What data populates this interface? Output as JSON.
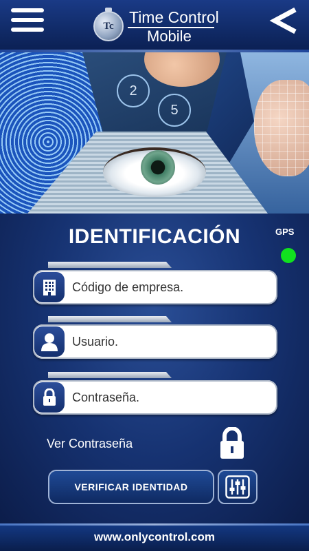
{
  "header": {
    "logo_initials": "Tc",
    "title_line1": "Time Control",
    "title_line2": "Mobile"
  },
  "banner": {
    "keypad_keys": [
      "2",
      "5"
    ]
  },
  "main": {
    "title": "IDENTIFICACIÓN",
    "gps_label": "GPS",
    "gps_color": "#11e11f",
    "fields": [
      {
        "placeholder": "Código de empresa.",
        "icon": "building-icon"
      },
      {
        "placeholder": "Usuario.",
        "icon": "user-icon"
      },
      {
        "placeholder": "Contraseña.",
        "icon": "lock-icon"
      }
    ],
    "show_password_label": "Ver Contraseña",
    "verify_button": "VERIFICAR IDENTIDAD",
    "settings_icon": "sliders-icon"
  },
  "footer": {
    "url": "www.onlycontrol.com"
  }
}
